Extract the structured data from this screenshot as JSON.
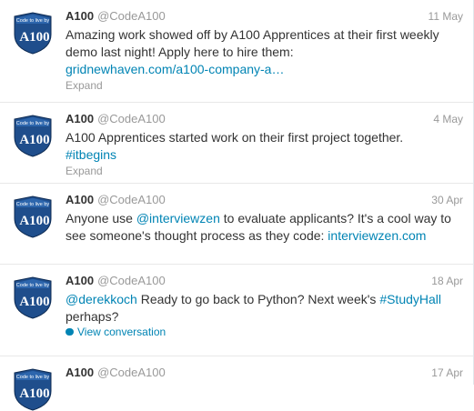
{
  "colors": {
    "link": "#0084b4",
    "muted": "#999999",
    "text": "#333333",
    "shield": "#1f4e8c"
  },
  "avatar_shield": {
    "top_label": "Code to live by",
    "main_label": "A100"
  },
  "tweets": [
    {
      "name": "A100",
      "handle": "@CodeA100",
      "date": "11 May",
      "text_line1": "Amazing work showed off by A100 Apprentices at their first weekly",
      "text_line2": "demo last night! Apply here to hire them:",
      "link": "gridnewhaven.com/a100-company-a…",
      "action": "Expand"
    },
    {
      "name": "A100",
      "handle": "@CodeA100",
      "date": "4 May",
      "text": "A100 Apprentices started work on their first project together.",
      "hashtag": "#itbegins",
      "action": "Expand"
    },
    {
      "name": "A100",
      "handle": "@CodeA100",
      "date": "30 Apr",
      "text_pre": "Anyone use ",
      "mention": "@interviewzen",
      "text_post": " to evaluate applicants? It's a cool way to",
      "text_line2": "see someone's thought process as they code: ",
      "link": "interviewzen.com"
    },
    {
      "name": "A100",
      "handle": "@CodeA100",
      "date": "18 Apr",
      "mention": "@derekkoch",
      "text_mid": " Ready to go back to Python? Next week's ",
      "hashtag": "#StudyHall",
      "text_line2": "perhaps?",
      "action": "View conversation"
    },
    {
      "name": "A100",
      "handle": "@CodeA100",
      "date": "17 Apr"
    }
  ]
}
